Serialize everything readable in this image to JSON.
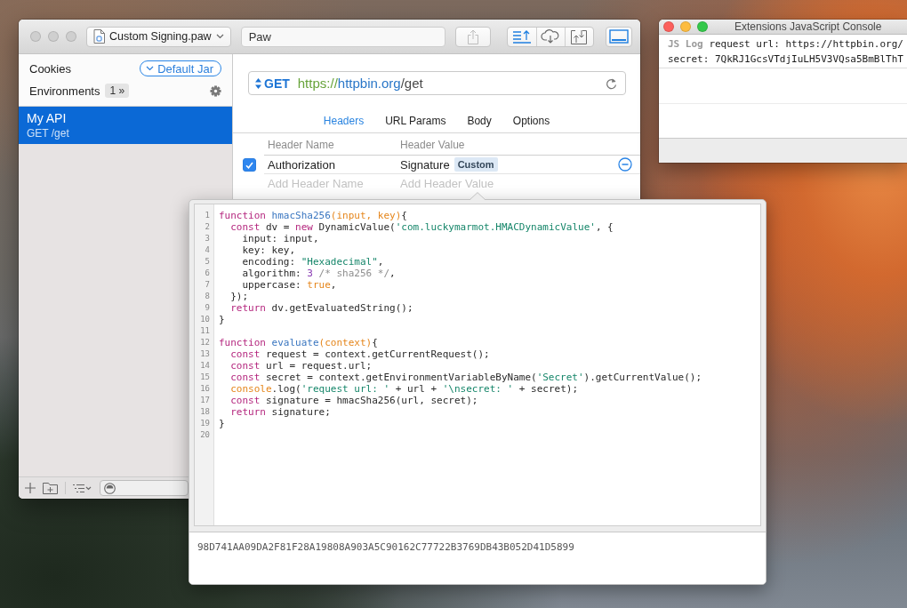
{
  "main_window": {
    "active": false,
    "document": "Custom Signing.paw",
    "title": "Paw",
    "toolbar": {
      "share_button": {
        "disabled": true
      },
      "segments": [
        {
          "kind": "list",
          "on": true
        },
        {
          "kind": "cloud",
          "on": false
        },
        {
          "kind": "transfer",
          "on": false
        }
      ],
      "layout_button": {
        "on": true
      }
    },
    "sidebar": {
      "cookies_label": "Cookies",
      "cookie_jar": "Default Jar",
      "environments_label": "Environments",
      "environments_count": "1 »",
      "requests": [
        {
          "name": "My API",
          "detail": "GET /get",
          "selected": true
        }
      ]
    },
    "request": {
      "method": "GET",
      "url": [
        {
          "text": "https://",
          "kind": "scheme"
        },
        {
          "text": "httpbin.org",
          "kind": "host"
        },
        {
          "text": "/get",
          "kind": "path"
        }
      ]
    },
    "tabs": [
      {
        "label": "Headers",
        "selected": true
      },
      {
        "label": "URL Params",
        "selected": false
      },
      {
        "label": "Body",
        "selected": false
      },
      {
        "label": "Options",
        "selected": false
      }
    ],
    "headers": {
      "columns": [
        "Header Name",
        "Header Value"
      ],
      "rows": [
        {
          "checked": true,
          "name": "Authorization",
          "value": "Signature",
          "tag": "Custom"
        }
      ],
      "new_row": {
        "name_placeholder": "Add Header Name",
        "value_placeholder": "Add Header Value"
      }
    }
  },
  "console_window": {
    "active": true,
    "title": "Extensions JavaScript Console",
    "entries": [
      {
        "source": "JS Log",
        "lines": [
          "request url: https://httpbin.org/",
          "secret: 7QkRJ1GcsVTdjIuLH5V3VQsa5BmBlThT"
        ]
      }
    ]
  },
  "code_editor": {
    "lines": [
      {
        "number": "1",
        "tokens": [
          {
            "text": "function ",
            "kind": "keyword"
          },
          {
            "text": "hmacSha256",
            "kind": "function"
          },
          {
            "text": "(input, key)",
            "kind": "parameter"
          },
          {
            "text": "{",
            "kind": "plain"
          }
        ]
      },
      {
        "number": "2",
        "tokens": [
          {
            "text": "  const ",
            "kind": "keyword"
          },
          {
            "text": "dv = ",
            "kind": "plain"
          },
          {
            "text": "new ",
            "kind": "keyword"
          },
          {
            "text": "DynamicValue(",
            "kind": "plain"
          },
          {
            "text": "'com.luckymarmot.HMACDynamicValue'",
            "kind": "string"
          },
          {
            "text": ", {",
            "kind": "plain"
          }
        ]
      },
      {
        "number": "3",
        "tokens": [
          {
            "text": "    input: input,",
            "kind": "plain"
          }
        ]
      },
      {
        "number": "4",
        "tokens": [
          {
            "text": "    key: key,",
            "kind": "plain"
          }
        ]
      },
      {
        "number": "5",
        "tokens": [
          {
            "text": "    encoding: ",
            "kind": "plain"
          },
          {
            "text": "\"Hexadecimal\"",
            "kind": "string"
          },
          {
            "text": ",",
            "kind": "plain"
          }
        ]
      },
      {
        "number": "6",
        "tokens": [
          {
            "text": "    algorithm: ",
            "kind": "plain"
          },
          {
            "text": "3",
            "kind": "number"
          },
          {
            "text": " /* sha256 */",
            "kind": "comment"
          },
          {
            "text": ",",
            "kind": "plain"
          }
        ]
      },
      {
        "number": "7",
        "tokens": [
          {
            "text": "    uppercase: ",
            "kind": "plain"
          },
          {
            "text": "true",
            "kind": "literal"
          },
          {
            "text": ",",
            "kind": "plain"
          }
        ]
      },
      {
        "number": "8",
        "tokens": [
          {
            "text": "  });",
            "kind": "plain"
          }
        ]
      },
      {
        "number": "9",
        "tokens": [
          {
            "text": "  return ",
            "kind": "keyword"
          },
          {
            "text": "dv.getEvaluatedString();",
            "kind": "plain"
          }
        ]
      },
      {
        "number": "10",
        "tokens": [
          {
            "text": "}",
            "kind": "plain"
          }
        ]
      },
      {
        "number": "11"
      },
      {
        "number": "12",
        "tokens": [
          {
            "text": "function ",
            "kind": "keyword"
          },
          {
            "text": "evaluate",
            "kind": "function"
          },
          {
            "text": "(context)",
            "kind": "parameter"
          },
          {
            "text": "{",
            "kind": "plain"
          }
        ]
      },
      {
        "number": "13",
        "tokens": [
          {
            "text": "  const ",
            "kind": "keyword"
          },
          {
            "text": "request = context.getCurrentRequest();",
            "kind": "plain"
          }
        ]
      },
      {
        "number": "14",
        "tokens": [
          {
            "text": "  const ",
            "kind": "keyword"
          },
          {
            "text": "url = request.url;",
            "kind": "plain"
          }
        ]
      },
      {
        "number": "15",
        "tokens": [
          {
            "text": "  const ",
            "kind": "keyword"
          },
          {
            "text": "secret = context.getEnvironmentVariableByName(",
            "kind": "plain"
          },
          {
            "text": "'Secret'",
            "kind": "string"
          },
          {
            "text": ").getCurrentValue();",
            "kind": "plain"
          }
        ]
      },
      {
        "number": "16",
        "tokens": [
          {
            "text": "  console",
            "kind": "literal"
          },
          {
            "text": ".log(",
            "kind": "plain"
          },
          {
            "text": "'request url: '",
            "kind": "string"
          },
          {
            "text": " + url + ",
            "kind": "plain"
          },
          {
            "text": "'\\nsecret: '",
            "kind": "string"
          },
          {
            "text": " + secret);",
            "kind": "plain"
          }
        ]
      },
      {
        "number": "17",
        "tokens": [
          {
            "text": "  const ",
            "kind": "keyword"
          },
          {
            "text": "signature = hmacSha256(url, secret);",
            "kind": "plain"
          }
        ]
      },
      {
        "number": "18",
        "tokens": [
          {
            "text": "  return ",
            "kind": "keyword"
          },
          {
            "text": "signature;",
            "kind": "plain"
          }
        ]
      },
      {
        "number": "19",
        "tokens": [
          {
            "text": "}",
            "kind": "plain"
          }
        ]
      },
      {
        "number": "20"
      }
    ],
    "result": "98D741AA09DA2F81F28A19808A903A5C90162C77722B3769DB43B052D41D5899"
  }
}
